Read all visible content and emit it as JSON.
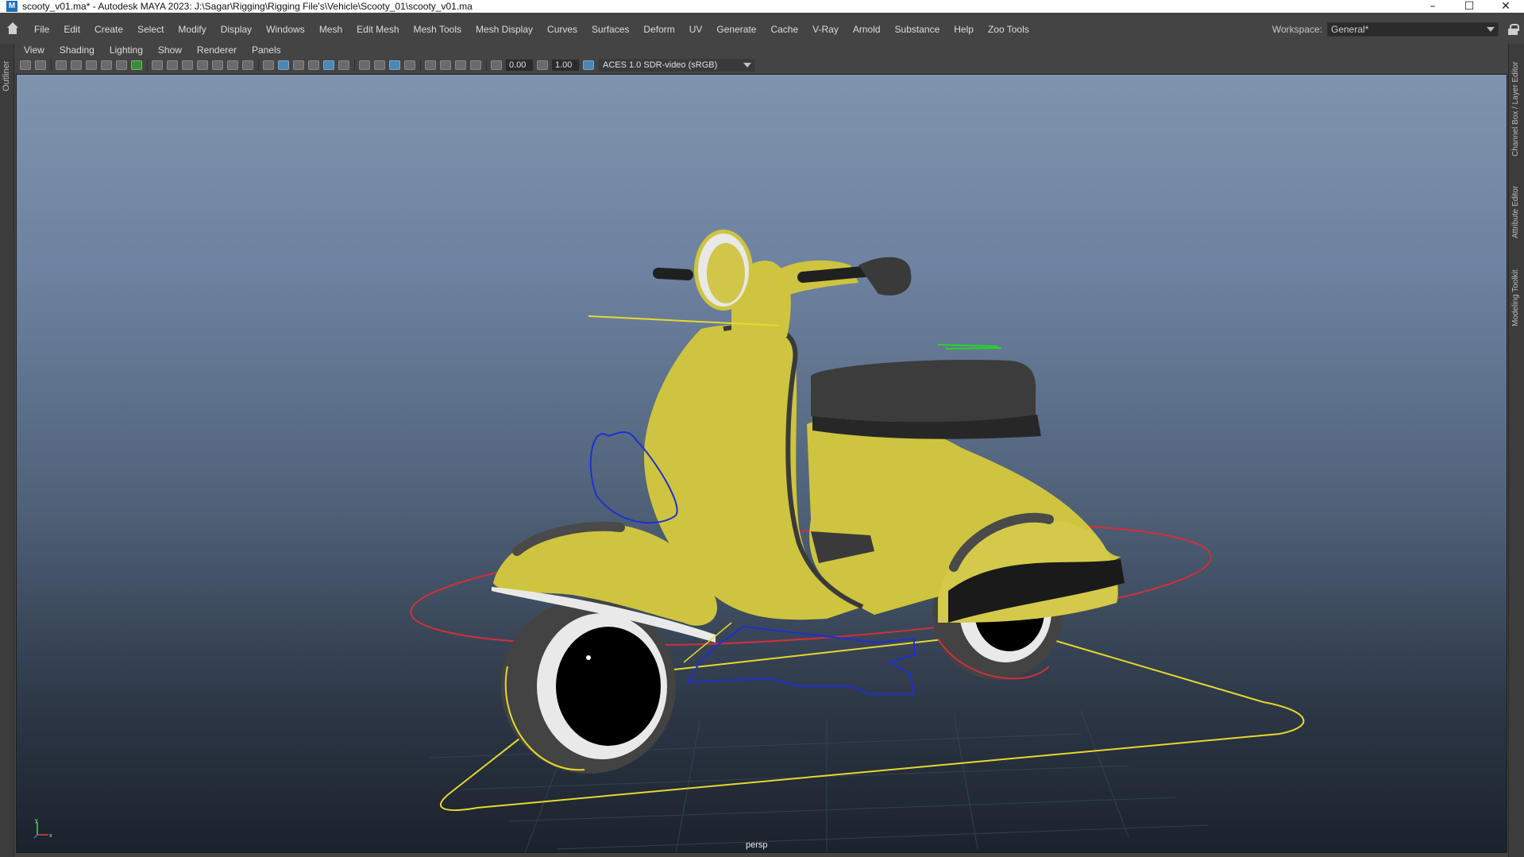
{
  "window": {
    "title": "scooty_v01.ma* - Autodesk MAYA 2023: J:\\Sagar\\Rigging\\Rigging File's\\Vehicle\\Scooty_01\\scooty_v01.ma",
    "app_icon": "M",
    "minimize": "–",
    "maximize": "☐",
    "close": "✕"
  },
  "menubar": {
    "items": [
      "File",
      "Edit",
      "Create",
      "Select",
      "Modify",
      "Display",
      "Windows",
      "Mesh",
      "Edit Mesh",
      "Mesh Tools",
      "Mesh Display",
      "Curves",
      "Surfaces",
      "Deform",
      "UV",
      "Generate",
      "Cache",
      "V-Ray",
      "Arnold",
      "Substance",
      "Help",
      "Zoo Tools"
    ],
    "workspace_label": "Workspace:",
    "workspace_value": "General*"
  },
  "panel_menu": {
    "items": [
      "View",
      "Shading",
      "Lighting",
      "Show",
      "Renderer",
      "Panels"
    ]
  },
  "panel_toolbar": {
    "exposure": "0.00",
    "gamma": "1.00",
    "color_space": "ACES 1.0 SDR-video (sRGB)"
  },
  "left_tabs": [
    "Outliner"
  ],
  "right_tabs": [
    "Channel Box / Layer Editor",
    "Attribute Editor",
    "Modeling Toolkit"
  ],
  "viewport": {
    "camera": "persp",
    "axis_labels": {
      "x": "x",
      "y": "y"
    },
    "colors": {
      "body": "#cfc43f",
      "seat": "#3c3c3c",
      "tire": "#424242",
      "rim": "#e9e9e9",
      "ctrl_red": "#d0303b",
      "ctrl_yellow": "#e5d92e",
      "ctrl_blue": "#1f2fcf",
      "ctrl_green": "#22d822"
    }
  }
}
